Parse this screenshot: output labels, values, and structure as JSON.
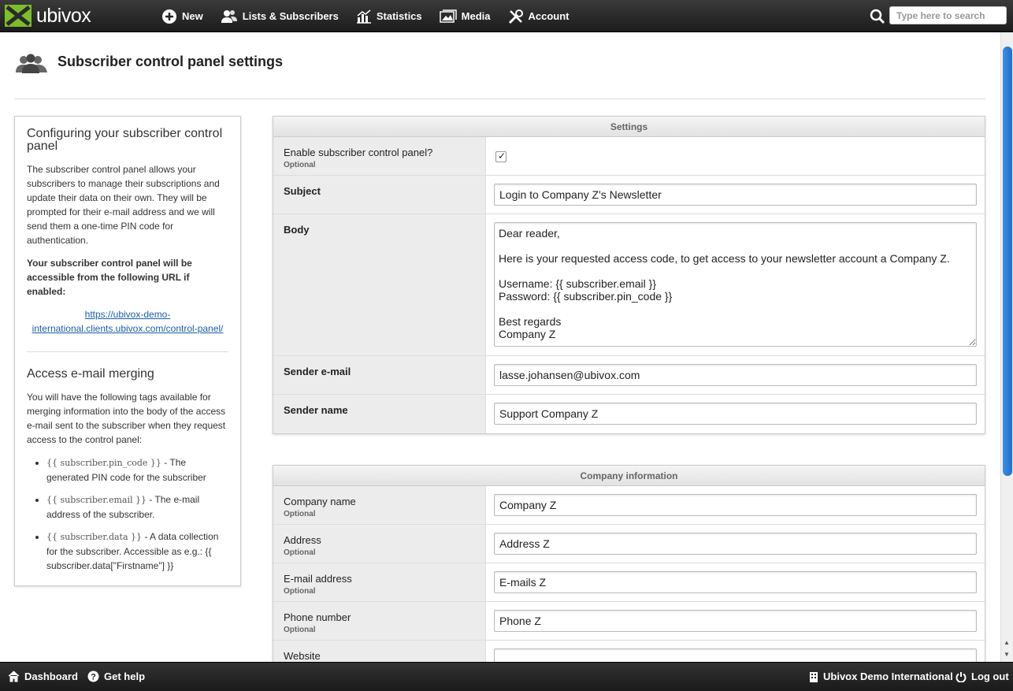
{
  "app": {
    "logo_text": "ubivox"
  },
  "nav": {
    "items": [
      {
        "label": "New",
        "icon": "plus-circle-icon"
      },
      {
        "label": "Lists & Subscribers",
        "icon": "users-icon"
      },
      {
        "label": "Statistics",
        "icon": "bar-chart-icon"
      },
      {
        "label": "Media",
        "icon": "images-icon"
      },
      {
        "label": "Account",
        "icon": "tools-icon"
      }
    ],
    "search_placeholder": "Type here to search"
  },
  "page": {
    "title": "Subscriber control panel settings"
  },
  "help": {
    "heading1": "Configuring your subscriber control panel",
    "para1": "The subscriber control panel allows your subscribers to manage their subscriptions and update their data on their own. They will be prompted for their e-mail address and we will send them a one-time PIN code for authentication.",
    "para2": "Your subscriber control panel will be accessible from the following URL if enabled:",
    "url": "https://ubivox-demo-international.clients.ubivox.com/control-panel/",
    "heading2": "Access e-mail merging",
    "para3": "You will have the following tags available for merging information into the body of the access e-mail sent to the subscriber when they request access to the control panel:",
    "tags": [
      {
        "tag": "{{ subscriber.pin_code }}",
        "desc": " - The generated PIN code for the subscriber"
      },
      {
        "tag": "{{ subscriber.email }}",
        "desc": " - The e-mail address of the subscriber."
      },
      {
        "tag": "{{ subscriber.data }}",
        "desc": " - A data collection for the subscriber. Accessible as e.g.: {{ subscriber.data[\"Firstname\"] }}"
      }
    ]
  },
  "settings": {
    "title": "Settings",
    "enable_label": "Enable subscriber control panel?",
    "enable_checked": true,
    "optional": "Optional",
    "subject_label": "Subject",
    "subject_value": "Login to Company Z's Newsletter",
    "body_label": "Body",
    "body_value": "Dear reader,\n\nHere is your requested access code, to get access to your newsletter account a Company Z.\n\nUsername: {{ subscriber.email }}\nPassword: {{ subscriber.pin_code }}\n\nBest regards\nCompany Z",
    "sender_email_label": "Sender e-mail",
    "sender_email_value": "lasse.johansen@ubivox.com",
    "sender_name_label": "Sender name",
    "sender_name_value": "Support Company Z"
  },
  "company": {
    "title": "Company information",
    "optional": "Optional",
    "name_label": "Company name",
    "name_value": "Company Z",
    "address_label": "Address",
    "address_value": "Address Z",
    "email_label": "E-mail address",
    "email_value": "E-mails Z",
    "phone_label": "Phone number",
    "phone_value": "Phone Z",
    "website_label": "Website",
    "website_value": ""
  },
  "footer": {
    "dashboard": "Dashboard",
    "help": "Get help",
    "org": "Ubivox Demo International",
    "logout": "Log out"
  }
}
